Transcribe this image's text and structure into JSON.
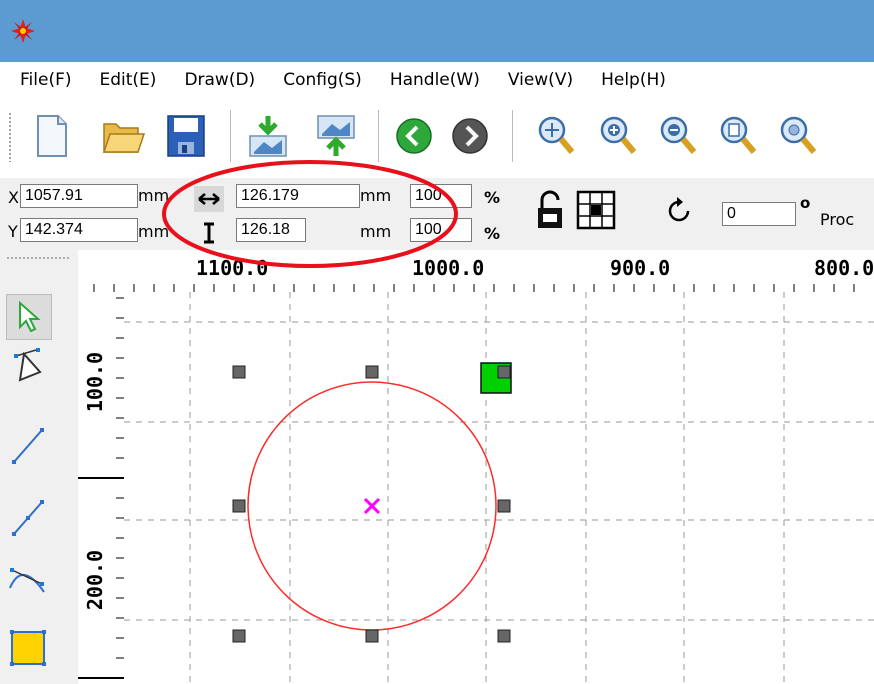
{
  "menu": [
    "File(F)",
    "Edit(E)",
    "Draw(D)",
    "Config(S)",
    "Handle(W)",
    "View(V)",
    "Help(H)"
  ],
  "toolbar_icons": [
    "new-file-icon",
    "open-folder-icon",
    "save-icon",
    "import-icon",
    "export-icon",
    "back-icon",
    "forward-icon",
    "zoom-window-icon",
    "zoom-in-icon",
    "zoom-out-icon",
    "zoom-page-icon",
    "zoom-fit-icon"
  ],
  "props": {
    "x_label": "X",
    "y_label": "Y",
    "x_value": "1057.91",
    "y_value": "142.374",
    "mm": "mm",
    "width_value": "126.179",
    "height_value": "126.18",
    "scale_w": "100",
    "scale_h": "100",
    "percent": "%",
    "rotate_value": "0",
    "degree": "o",
    "proc_label": "Proc"
  },
  "ruler": {
    "top_labels": [
      "1100.0",
      "1000.0",
      "900.0",
      "800.0"
    ],
    "left_labels": [
      "100.0",
      "200.0"
    ]
  },
  "colors": {
    "titlebar": "#5b9bd2",
    "circle": "#ff2a2a",
    "center_mark": "#ff00ff",
    "anchor": "#00d000",
    "highlight": "#e8101a"
  }
}
